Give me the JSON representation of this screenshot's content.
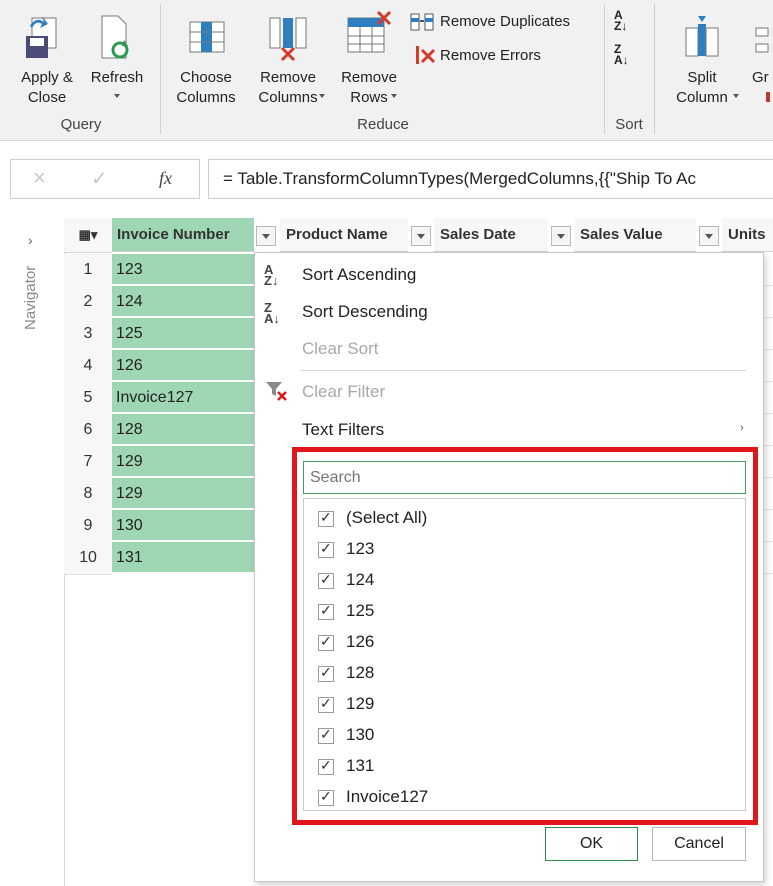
{
  "ribbon": {
    "apply_close": "Apply &\nClose",
    "refresh": "Refresh",
    "choose_columns": "Choose\nColumns",
    "remove_columns": "Remove\nColumns",
    "remove_rows": "Remove\nRows",
    "remove_duplicates": "Remove Duplicates",
    "remove_errors": "Remove Errors",
    "split_column": "Split\nColumn",
    "group_by_partial": "Gr",
    "groups": {
      "query": "Query",
      "reduce": "Reduce",
      "sort": "Sort"
    }
  },
  "formula": {
    "fx": "fx",
    "text": "= Table.TransformColumnTypes(MergedColumns,{{\"Ship To Ac"
  },
  "navigator": {
    "label": "Navigator"
  },
  "grid": {
    "headers": [
      "Invoice Number",
      "Product Name",
      "Sales Date",
      "Sales Value",
      "Units"
    ],
    "rows": [
      {
        "n": "1",
        "v": "123"
      },
      {
        "n": "2",
        "v": "124"
      },
      {
        "n": "3",
        "v": "125"
      },
      {
        "n": "4",
        "v": "126"
      },
      {
        "n": "5",
        "v": "Invoice127"
      },
      {
        "n": "6",
        "v": "128"
      },
      {
        "n": "7",
        "v": "129"
      },
      {
        "n": "8",
        "v": "129"
      },
      {
        "n": "9",
        "v": "130"
      },
      {
        "n": "10",
        "v": "131"
      }
    ]
  },
  "dropdown": {
    "sort_ascending": "Sort Ascending",
    "sort_descending": "Sort Descending",
    "clear_sort": "Clear Sort",
    "clear_filter": "Clear Filter",
    "text_filters": "Text Filters",
    "search_placeholder": "Search",
    "items": [
      "(Select All)",
      "123",
      "124",
      "125",
      "126",
      "128",
      "129",
      "130",
      "131",
      "Invoice127"
    ],
    "ok": "OK",
    "cancel": "Cancel"
  },
  "colors": {
    "selected_column": "#9fd6b3",
    "highlight_box": "#e0161c",
    "search_border": "#4a9a64"
  }
}
